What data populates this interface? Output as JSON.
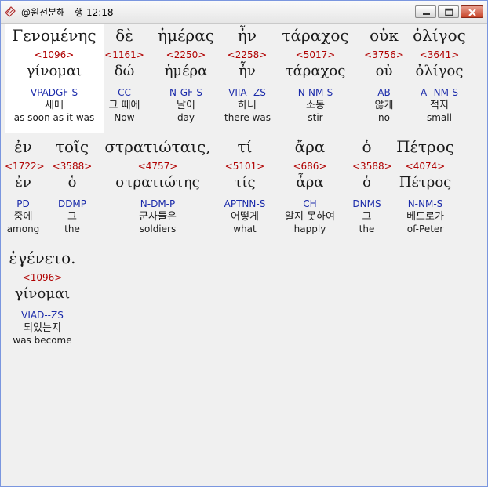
{
  "window": {
    "title": "@원전분해 - 행 12:18"
  },
  "rows": [
    [
      {
        "greek": "Γενομένης",
        "strong": "<1096>",
        "lemma": "γίνομαι",
        "morph": "VPADGF-S",
        "korean": "새매",
        "english": "as soon as it was",
        "selected": true
      },
      {
        "greek": "δὲ",
        "strong": "<1161>",
        "lemma": "δώ",
        "morph": "CC",
        "korean": "그 때에",
        "english": "Now"
      },
      {
        "greek": "ἡμέρας",
        "strong": "<2250>",
        "lemma": "ἡμέρα",
        "morph": "N-GF-S",
        "korean": "날이",
        "english": "day"
      },
      {
        "greek": "ἦν",
        "strong": "<2258>",
        "lemma": "ἦν",
        "morph": "VIIA--ZS",
        "korean": "하니",
        "english": "there was"
      },
      {
        "greek": "τάραχος",
        "strong": "<5017>",
        "lemma": "τάραχος",
        "morph": "N-NM-S",
        "korean": "소동",
        "english": "stir"
      },
      {
        "greek": "οὐκ",
        "strong": "<3756>",
        "lemma": "οὐ",
        "morph": "AB",
        "korean": "않게",
        "english": "no"
      },
      {
        "greek": "ὀλίγος",
        "strong": "<3641>",
        "lemma": "ὀλίγος",
        "morph": "A--NM-S",
        "korean": "적지",
        "english": "small"
      }
    ],
    [
      {
        "greek": "ἐν",
        "strong": "<1722>",
        "lemma": "ἐν",
        "morph": "PD",
        "korean": "중에",
        "english": "among"
      },
      {
        "greek": "τοῖς",
        "strong": "<3588>",
        "lemma": "ὁ",
        "morph": "DDMP",
        "korean": "그",
        "english": "the"
      },
      {
        "greek": "στρατιώταις,",
        "strong": "<4757>",
        "lemma": "στρατιώτης",
        "morph": "N-DM-P",
        "korean": "군사들은",
        "english": "soldiers"
      },
      {
        "greek": "τί",
        "strong": "<5101>",
        "lemma": "τίς",
        "morph": "APTNN-S",
        "korean": "어떻게",
        "english": "what"
      },
      {
        "greek": "ἄρα",
        "strong": "<686>",
        "lemma": "ἆρα",
        "morph": "CH",
        "korean": "알지 못하여",
        "english": "happly"
      },
      {
        "greek": "ὁ",
        "strong": "<3588>",
        "lemma": "ὁ",
        "morph": "DNMS",
        "korean": "그",
        "english": "the"
      },
      {
        "greek": "Πέτρος",
        "strong": "<4074>",
        "lemma": "Πέτρος",
        "morph": "N-NM-S",
        "korean": "베드로가",
        "english": "of-Peter"
      }
    ],
    [
      {
        "greek": "ἐγένετο.",
        "strong": "<1096>",
        "lemma": "γίνομαι",
        "morph": "VIAD--ZS",
        "korean": "되었는지",
        "english": "was become"
      }
    ]
  ]
}
